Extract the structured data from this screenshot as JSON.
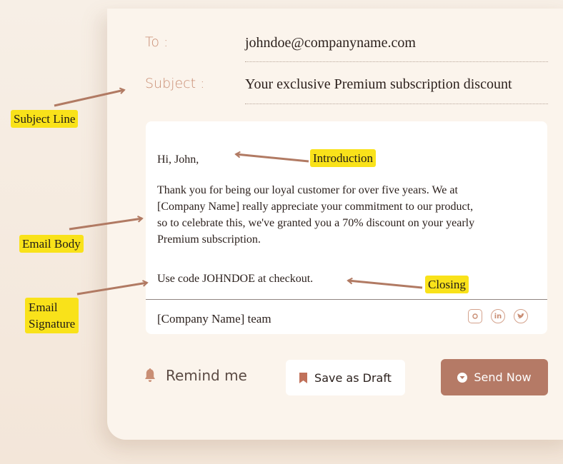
{
  "email": {
    "to_label": "To :",
    "to_value": "johndoe@companyname.com",
    "subject_label": "Subject :",
    "subject_value": "Your exclusive Premium subscription discount",
    "greeting": "Hi, John,",
    "body_lines": [
      "Thank you for being our loyal customer for over five years. We at",
      "[Company Name] really appreciate your commitment to our product,",
      "so to celebrate this, we've granted you a 70% discount on your yearly",
      "Premium subscription."
    ],
    "closing": "Use code JOHNDOE at checkout.",
    "signature": "[Company Name] team"
  },
  "social_icons": [
    "instagram-icon",
    "linkedin-icon",
    "twitter-icon"
  ],
  "social_glyphs": {
    "linkedin": "in"
  },
  "actions": {
    "remind_label": "Remind me",
    "draft_label": "Save as Draft",
    "send_label": "Send Now"
  },
  "annotations": {
    "subject_line": "Subject Line",
    "introduction": "Introduction",
    "email_body": "Email Body",
    "email_signature_line1": "Email",
    "email_signature_line2": "Signature",
    "closing": "Closing"
  },
  "colors": {
    "accent": "#b57a66",
    "label": "#c98e74",
    "highlight": "#f9e21a",
    "arrow": "#b17a63",
    "background": "#fbf4ec"
  }
}
